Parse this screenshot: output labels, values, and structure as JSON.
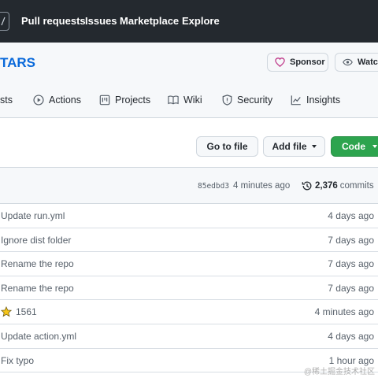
{
  "topnav": {
    "links": [
      "Pull requests",
      "Issues",
      "Marketplace",
      "Explore"
    ]
  },
  "repo": {
    "title": "TARS",
    "sponsor_label": "Sponsor",
    "watch_label": "Watch"
  },
  "tabs": [
    {
      "label": "sts",
      "icon": "pull-request-icon"
    },
    {
      "label": "Actions",
      "icon": "play-icon"
    },
    {
      "label": "Projects",
      "icon": "project-icon"
    },
    {
      "label": "Wiki",
      "icon": "book-icon"
    },
    {
      "label": "Security",
      "icon": "shield-icon"
    },
    {
      "label": "Insights",
      "icon": "graph-icon"
    }
  ],
  "actions": {
    "go_to_file": "Go to file",
    "add_file": "Add file",
    "code": "Code"
  },
  "commit_bar": {
    "hash": "85edbd3",
    "time": "4 minutes ago",
    "count": "2,376",
    "count_label": "commits"
  },
  "rows": [
    {
      "message": "Update run.yml",
      "age": "4 days ago"
    },
    {
      "message": "Ignore dist folder",
      "age": "7 days ago"
    },
    {
      "message": "Rename the repo",
      "age": "7 days ago"
    },
    {
      "message": "Rename the repo",
      "age": "7 days ago"
    },
    {
      "message": "1561",
      "age": "4 minutes ago",
      "icon": "star-icon"
    },
    {
      "message": "Update action.yml",
      "age": "4 days ago"
    },
    {
      "message": "Fix typo",
      "age": "1 hour ago"
    }
  ],
  "watermark": "@稀土掘金技术社区",
  "colors": {
    "nav_bg": "#24292f",
    "link": "#0969da",
    "code_button": "#2da44e",
    "sponsor_heart": "#bf3989"
  }
}
